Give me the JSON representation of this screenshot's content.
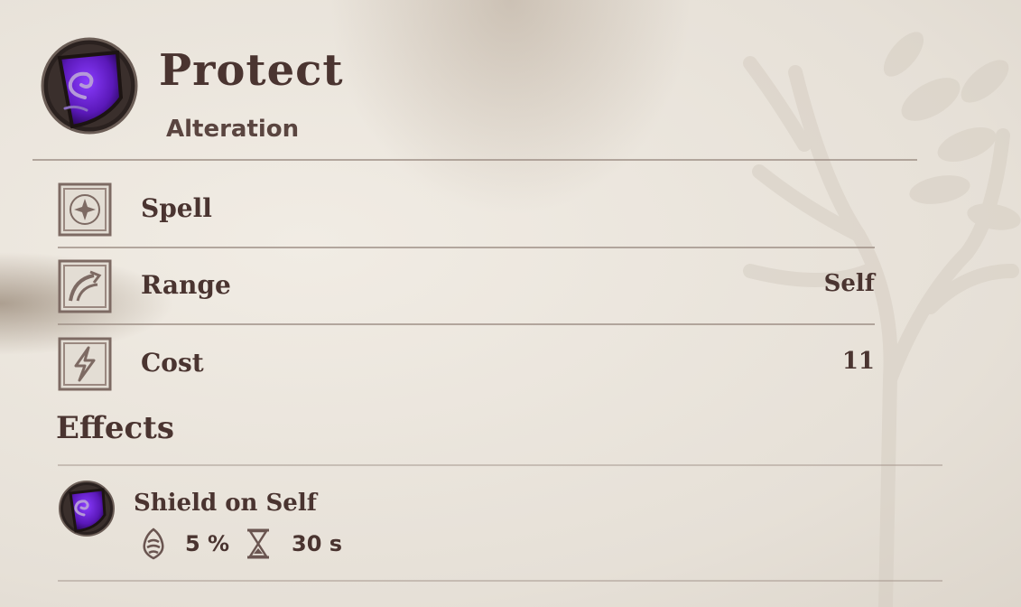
{
  "spell": {
    "name": "Protect",
    "school": "Alteration",
    "icon": "shield-swirl-icon",
    "accent_color": "#6b2bd1"
  },
  "properties": [
    {
      "icon": "spell-star-icon",
      "label": "Spell",
      "value": ""
    },
    {
      "icon": "range-arrow-icon",
      "label": "Range",
      "value": "Self"
    },
    {
      "icon": "lightning-cost-icon",
      "label": "Cost",
      "value": "11"
    }
  ],
  "effects": {
    "title": "Effects",
    "items": [
      {
        "icon": "shield-swirl-icon",
        "name": "Shield on Self",
        "magnitude": "5 %",
        "magnitude_icon": "magnitude-icon",
        "duration": "30 s",
        "duration_icon": "hourglass-icon"
      }
    ]
  }
}
